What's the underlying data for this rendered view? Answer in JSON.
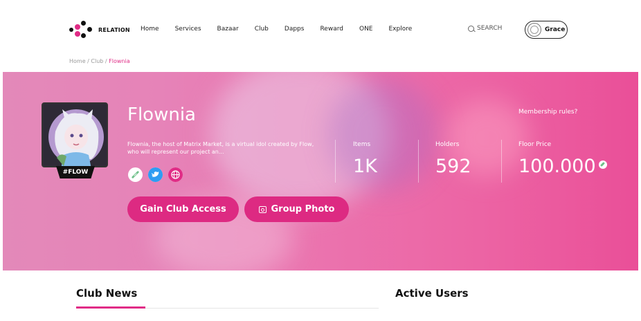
{
  "brand": {
    "name": "RELATION"
  },
  "nav": {
    "items": [
      {
        "label": "Home"
      },
      {
        "label": "Services"
      },
      {
        "label": "Bazaar"
      },
      {
        "label": "Club"
      },
      {
        "label": "Dapps"
      },
      {
        "label": "Reward"
      },
      {
        "label": "ONE"
      },
      {
        "label": "Explore"
      }
    ],
    "search_label": "SEARCH",
    "user_name": "Grace"
  },
  "breadcrumb": {
    "home": "Home",
    "sep1": " / ",
    "club": "Club",
    "sep2": " / ",
    "current": "Flownia"
  },
  "club": {
    "name": "Flownia",
    "tag": "#FLOW",
    "description": "Flownia, the host of Matrix Market, is a virtual idol created by Flow, who will represent our project an...",
    "socials": [
      "link-icon",
      "twitter-icon",
      "globe-icon"
    ],
    "rules_link": "Membership rules?",
    "stats": {
      "items_label": "Items",
      "items_value": "1K",
      "holders_label": "Holders",
      "holders_value": "592",
      "floor_label": "Floor Price",
      "floor_value": "100.000"
    },
    "actions": {
      "access": "Gain Club Access",
      "photo": "Group Photo"
    }
  },
  "sections": {
    "news": "Club News",
    "users": "Active Users"
  },
  "colors": {
    "accent": "#dd2a82",
    "hero_pink": "#ea4f98",
    "link_green": "#6fc08a"
  }
}
